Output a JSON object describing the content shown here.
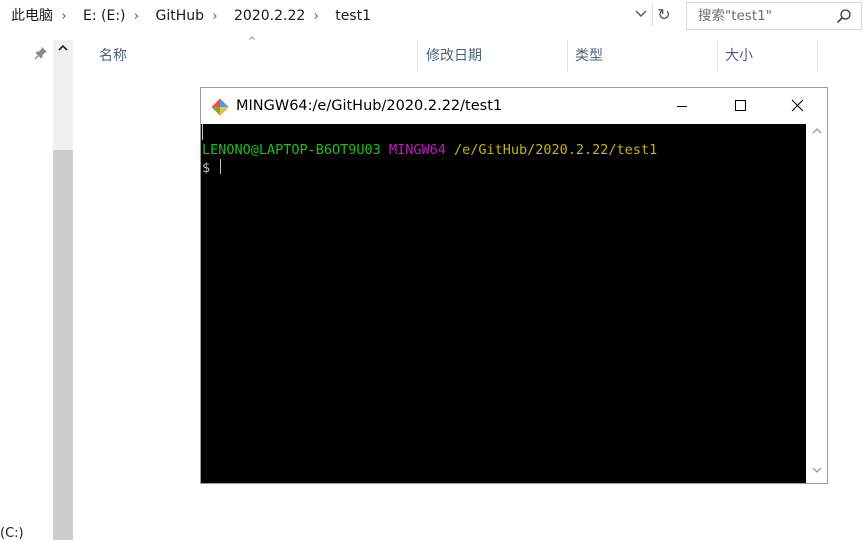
{
  "explorer": {
    "breadcrumb": [
      "此电脑",
      "E: (E:)",
      "GitHub",
      "2020.2.22",
      "test1"
    ],
    "search_placeholder": "搜索\"test1\"",
    "columns": [
      "名称",
      "修改日期",
      "类型",
      "大小"
    ],
    "nav_drive_label": "(C:)"
  },
  "git_window": {
    "title": "MINGW64:/e/GitHub/2020.2.22/test1",
    "terminal": {
      "user_host": "LENONO@LAPTOP-B6OT9U03",
      "system": "MINGW64",
      "path": "/e/GitHub/2020.2.22/test1",
      "prompt": "$"
    }
  },
  "icons": [
    "chevron-right-icon",
    "chevron-down-icon",
    "refresh-icon",
    "search-icon",
    "pin-icon",
    "git-icon",
    "minimize-icon",
    "maximize-icon",
    "close-icon"
  ],
  "colors": {
    "terminal_bg": "#000000",
    "user_host": "#1ebf1e",
    "system": "#c11bbf",
    "path": "#c8b400",
    "column_header": "#4c607a"
  }
}
